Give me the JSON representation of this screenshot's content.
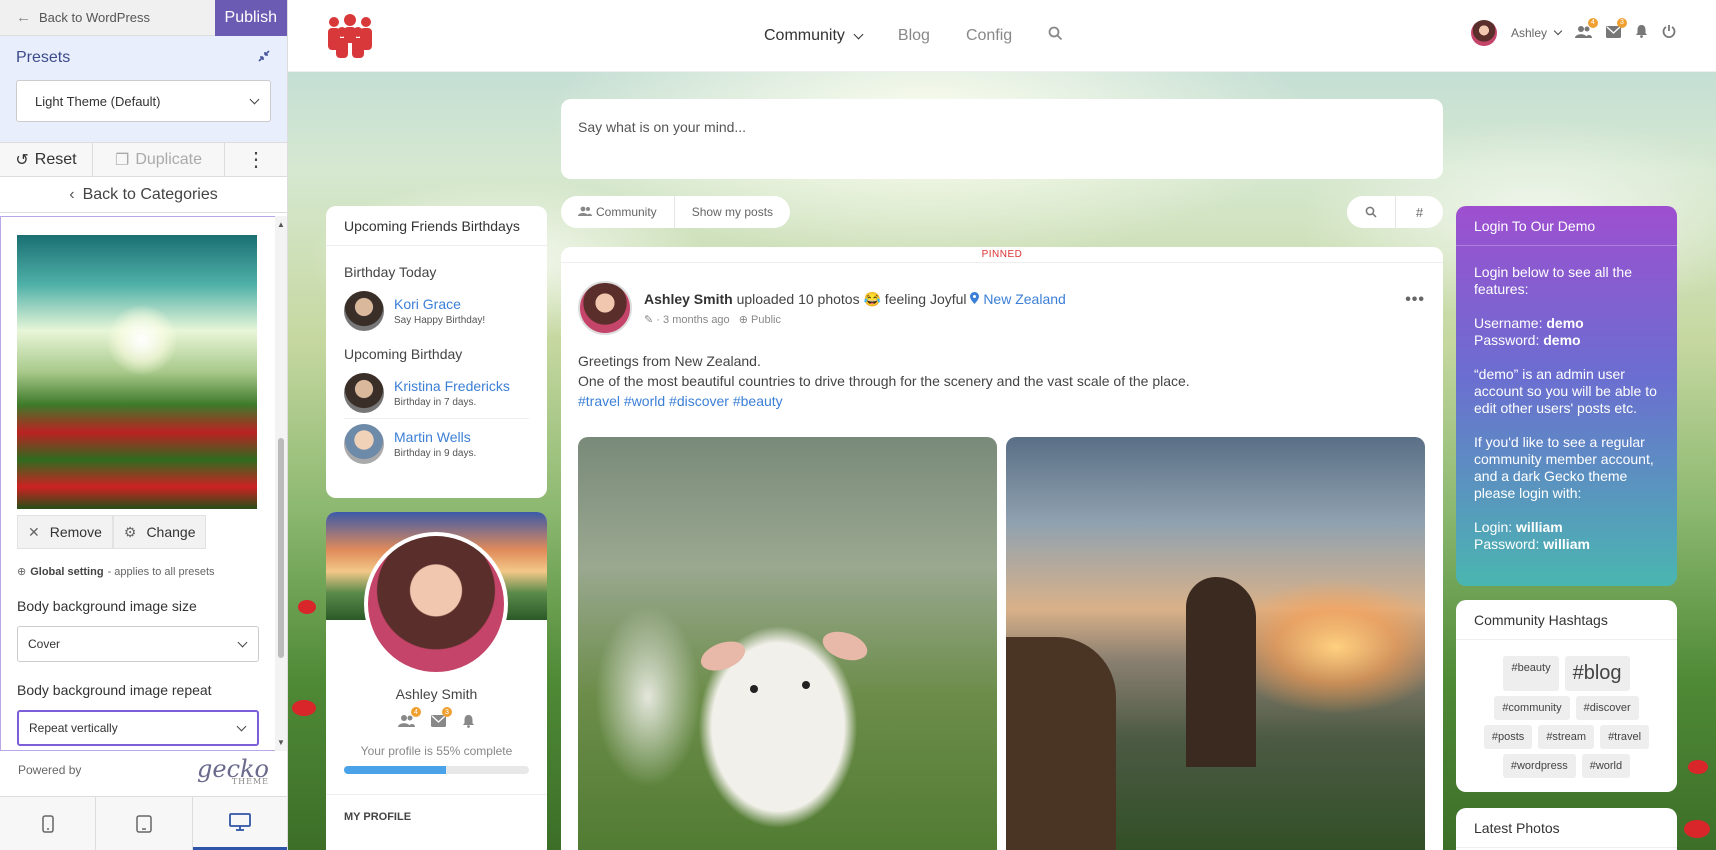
{
  "customizer": {
    "back_label": "Back to WordPress",
    "publish_label": "Publish",
    "presets_title": "Presets",
    "preset_selected": "Light Theme (Default)",
    "reset_label": "Reset",
    "duplicate_label": "Duplicate",
    "back_categories_label": "Back to Categories",
    "remove_label": "Remove",
    "change_label": "Change",
    "global_bold": "Global setting",
    "global_rest": "- applies to all presets",
    "size_label": "Body background image size",
    "size_value": "Cover",
    "repeat_label": "Body background image repeat",
    "repeat_value": "Repeat vertically",
    "powered_by": "Powered by",
    "powered_logo": "gecko",
    "powered_logo_sub": "THEME"
  },
  "header": {
    "nav": [
      "Community",
      "Blog",
      "Config"
    ],
    "user_name": "Ashley",
    "badges": {
      "friends": "4",
      "messages": "3"
    }
  },
  "compose": {
    "placeholder": "Say what is on your mind..."
  },
  "filters": [
    "Community",
    "Show my posts"
  ],
  "tools": {
    "hash": "#"
  },
  "post": {
    "pinned": "PINNED",
    "author": "Ashley Smith",
    "action": " uploaded 10 photos ",
    "emoji": "😂",
    "feeling": " feeling Joyful ",
    "location": "New Zealand",
    "time": "3 months ago",
    "privacy": "Public",
    "body_line1": "Greetings from New Zealand.",
    "body_line2": "One of the most beautiful countries to drive through for the scenery and the vast scale of the place.",
    "tags": "#travel #world #discover #beauty"
  },
  "birthdays": {
    "title": "Upcoming Friends Birthdays",
    "today_label": "Birthday Today",
    "today": [
      {
        "name": "Kori Grace",
        "note": "Say Happy Birthday!"
      }
    ],
    "upcoming_label": "Upcoming Birthday",
    "upcoming": [
      {
        "name": "Kristina Fredericks",
        "note": "Birthday in 7 days."
      },
      {
        "name": "Martin Wells",
        "note": "Birthday in 9 days."
      }
    ]
  },
  "profile": {
    "name": "Ashley Smith",
    "complete_text": "Your profile is 55% complete",
    "complete_value": 55,
    "badges": {
      "friends": "4",
      "messages": "3"
    },
    "my_profile": "MY PROFILE"
  },
  "demo": {
    "title": "Login To Our Demo",
    "intro": "Login below to see all the features:",
    "username_label": "Username: ",
    "username": "demo",
    "password_label": "Password: ",
    "password": "demo",
    "admin_note": "“demo” is an admin user account so you will be able to edit other users' posts etc.",
    "regular_note": "If you'd like to see a regular community member account, and a dark Gecko theme please login with:",
    "login_label": "Login: ",
    "login": "william",
    "password2": "william"
  },
  "hashtags": {
    "title": "Community Hashtags",
    "items": [
      "#beauty",
      "#blog",
      "#community",
      "#discover",
      "#posts",
      "#stream",
      "#travel",
      "#wordpress",
      "#world"
    ]
  },
  "latest_photos": {
    "title": "Latest Photos"
  },
  "colors": {
    "accent": "#6b5bb3",
    "link": "#3b7fd6",
    "demo_top": "#9e4fd0",
    "demo_bottom": "#4ab6b0"
  }
}
